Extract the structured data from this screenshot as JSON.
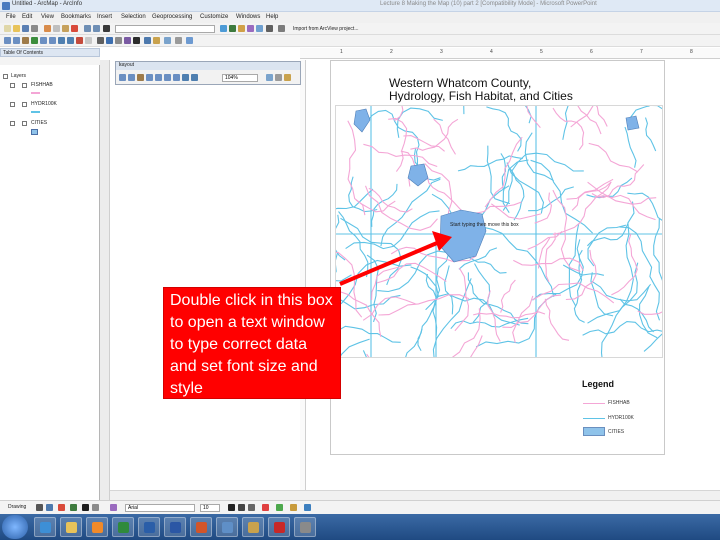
{
  "window": {
    "title": "Untitled - ArcMap - ArcInfo",
    "doc_title": "Lecture 8 Making the Map (10) part 2 [Compatibility Mode] - Microsoft PowerPoint"
  },
  "menu": [
    "File",
    "Edit",
    "View",
    "Bookmarks",
    "Insert",
    "Selection",
    "Geoprocessing",
    "Customize",
    "Windows",
    "Help"
  ],
  "toolbar": {
    "import_label": "Import from ArcView project..."
  },
  "toc": {
    "title": "Table Of Contents",
    "root": "Layers",
    "layers": [
      "FISHHAB",
      "HYDR100K",
      "CITIES"
    ]
  },
  "layout_window": {
    "title": "Layout",
    "zoom": "104%"
  },
  "ruler": [
    "1",
    "2",
    "3",
    "4",
    "5",
    "6",
    "7",
    "8"
  ],
  "map": {
    "title_line1": "Western Whatcom County,",
    "title_line2": "Hydrology, Fish Habitat, and Cities",
    "inset_text": "Start typing then move this box",
    "colors": {
      "fishhab": "#f4a6d6",
      "hydro": "#5fc3e6",
      "cities": "#7fb2e8"
    }
  },
  "legend": {
    "title": "Legend",
    "items": [
      "FISHHAB",
      "HYDR100K",
      "CITIES"
    ]
  },
  "callout": {
    "text": "Double click in this box to open a text window to type correct data and set font size and style",
    "color": "#ff0000"
  },
  "drawing": {
    "label": "Drawing",
    "font": "Arial",
    "size": "10"
  }
}
